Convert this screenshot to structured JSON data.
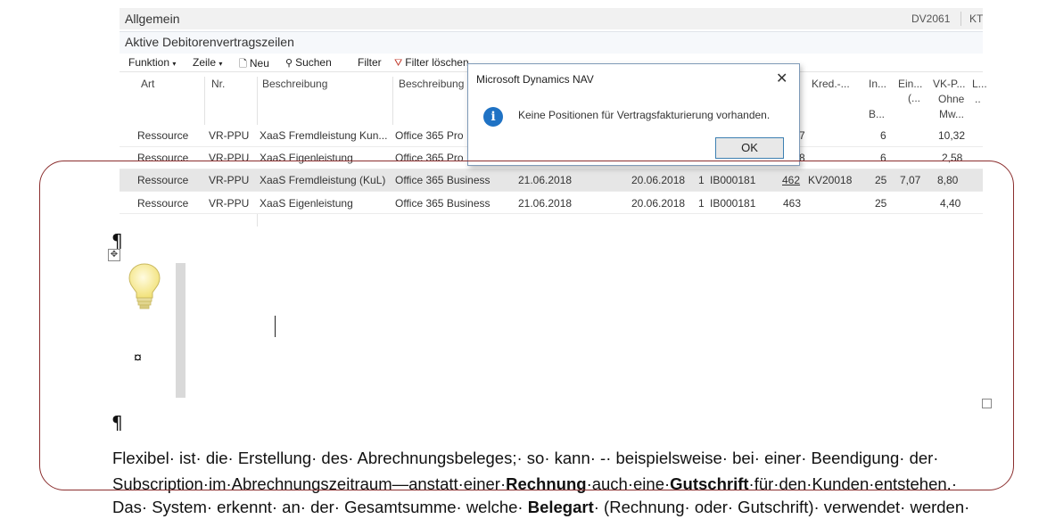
{
  "header": {
    "title": "Allgemein",
    "code": "DV2061",
    "kt": "KT"
  },
  "subheader": {
    "title": "Aktive Debitorenvertragszeilen"
  },
  "toolbar": {
    "funktion": "Funktion",
    "zeile": "Zeile",
    "neu": "Neu",
    "suchen": "Suchen",
    "filter": "Filter",
    "filter_loeschen": "Filter löschen"
  },
  "columns": {
    "art": "Art",
    "nr": "Nr.",
    "beschreibung": "Beschreibung",
    "beschreibung2": "Beschreibung",
    "kred": "Kred.-...",
    "in_1": "In...",
    "in_2": "B...",
    "ein_1": "Ein...",
    "ein_2": "(...",
    "vk_1": "VK-P...",
    "vk_2": "Ohne",
    "vk_3": "Mw...",
    "l_1": "L...",
    "l_2": ".."
  },
  "rows": [
    {
      "art": "Ressource",
      "nr": "VR-PPU",
      "beschreibung": "XaaS Fremdleistung Kun...",
      "beschreibung2": "Office 365 Pro",
      "num": "7",
      "in": "6",
      "vk": "10,32"
    },
    {
      "art": "Ressource",
      "nr": "VR-PPU",
      "beschreibung": "XaaS Eigenleistung",
      "beschreibung2": "Office 365 Pro",
      "num": "8",
      "in": "6",
      "vk": "2,58"
    },
    {
      "art": "Ressource",
      "nr": "VR-PPU",
      "beschreibung": "XaaS Fremdleistung (KuL)",
      "beschreibung2": "Office 365 Business",
      "d1": "21.06.2018",
      "d2": "20.06.2018",
      "one": "1",
      "ib": "IB000181",
      "num": "462",
      "kred": "KV20018",
      "in": "25",
      "ein": "7,07",
      "vk": "8,80"
    },
    {
      "art": "Ressource",
      "nr": "VR-PPU",
      "beschreibung": "XaaS Eigenleistung",
      "beschreibung2": "Office 365 Business",
      "d1": "21.06.2018",
      "d2": "20.06.2018",
      "one": "1",
      "ib": "IB000181",
      "num": "463",
      "in": "25",
      "vk": "4,40"
    }
  ],
  "dialog": {
    "title": "Microsoft Dynamics NAV",
    "message": "Keine Positionen für Vertragsfakturierung vorhanden.",
    "ok": "OK"
  },
  "doc": {
    "pilcrow": "¶",
    "cellmark": "¤",
    "line1": "Flexibel· ist· die· Erstellung· des· Abrechnungsbeleges;· so· kann· -· beispielsweise· bei· einer· Beendigung· der·",
    "line2_a": "Subscription·im·Abrechnungszeitraum—anstatt·einer·",
    "line2_b": "Rechnung",
    "line2_c": "·auch·eine·",
    "line2_d": "Gutschrift",
    "line2_e": "·für·den·Kunden·entstehen.·",
    "line3_a": "Das· System· erkennt· an· der· Gesamtsumme· welche· ",
    "line3_b": "Belegart",
    "line3_c": "· (Rechnung· oder· Gutschrift)· verwendet· werden·"
  },
  "colors": {
    "accent": "#1f72c4",
    "dialog_border": "#7f9ab8",
    "annotation": "#8b2e2e"
  }
}
